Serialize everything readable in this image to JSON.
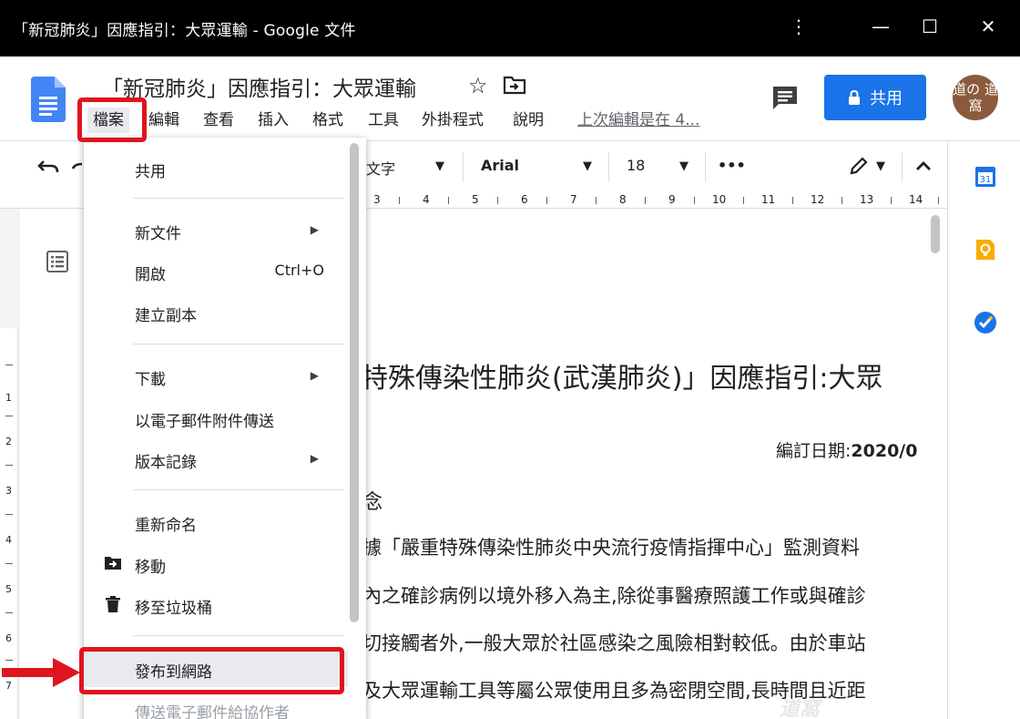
{
  "window": {
    "title": "「新冠肺炎」因應指引：大眾運輸 - Google 文件",
    "more_icon": "⋮",
    "minimize_icon": "—",
    "maximize_icon": "☐",
    "close_icon": "✕"
  },
  "header": {
    "doc_title": "「新冠肺炎」因應指引：大眾運輸",
    "star": "☆",
    "menu": [
      "檔案",
      "編輯",
      "查看",
      "插入",
      "格式",
      "工具",
      "外掛程式",
      "說明"
    ],
    "last_edit": "上次編輯是在 4...",
    "share_label": "共用",
    "avatar_text": "道の 道窩"
  },
  "toolbar": {
    "style_value": "文字",
    "font_value": "Arial",
    "size_value": "18",
    "more": "•••",
    "collapse": "︿"
  },
  "ruler": {
    "numbers": [
      "3",
      "4",
      "5",
      "6",
      "7",
      "8",
      "9",
      "10",
      "11",
      "12",
      "13",
      "14"
    ],
    "vertical_numbers": [
      "1",
      "2",
      "3",
      "4",
      "5",
      "6",
      "7"
    ]
  },
  "document": {
    "heading_fragment": "特殊傳染性肺炎(武漢肺炎)」因應指引:大眾",
    "date_label": "編訂日期:",
    "date_value": "2020/0",
    "section_fragment": "念",
    "para_lines": [
      "據「嚴重特殊傳染性肺炎中央流行疫情指揮中心」監測資料",
      "內之確診病例以境外移入為主,除從事醫療照護工作或與確診",
      "切接觸者外,一般大眾於社區感染之風險相對較低。由於車站",
      "及大眾運輸工具等屬公眾使用且多為密閉空間,長時間且近距"
    ]
  },
  "file_menu": {
    "items": [
      {
        "label": "共用"
      },
      {
        "label": "新文件",
        "submenu": true
      },
      {
        "label": "開啟",
        "shortcut": "Ctrl+O"
      },
      {
        "label": "建立副本"
      },
      {
        "label": "下載",
        "submenu": true
      },
      {
        "label": "以電子郵件附件傳送"
      },
      {
        "label": "版本記錄",
        "submenu": true
      },
      {
        "label": "重新命名"
      },
      {
        "label": "移動",
        "icon": "move-icon"
      },
      {
        "label": "移至垃圾桶",
        "icon": "trash-icon"
      },
      {
        "label": "發布到網路"
      },
      {
        "label": "傳送電子郵件給協作者"
      }
    ],
    "arrow": "▶"
  },
  "watermark": "道窩",
  "colors": {
    "accent": "#1a73e8",
    "highlight": "#e0141e",
    "titlebar": "#000000"
  }
}
